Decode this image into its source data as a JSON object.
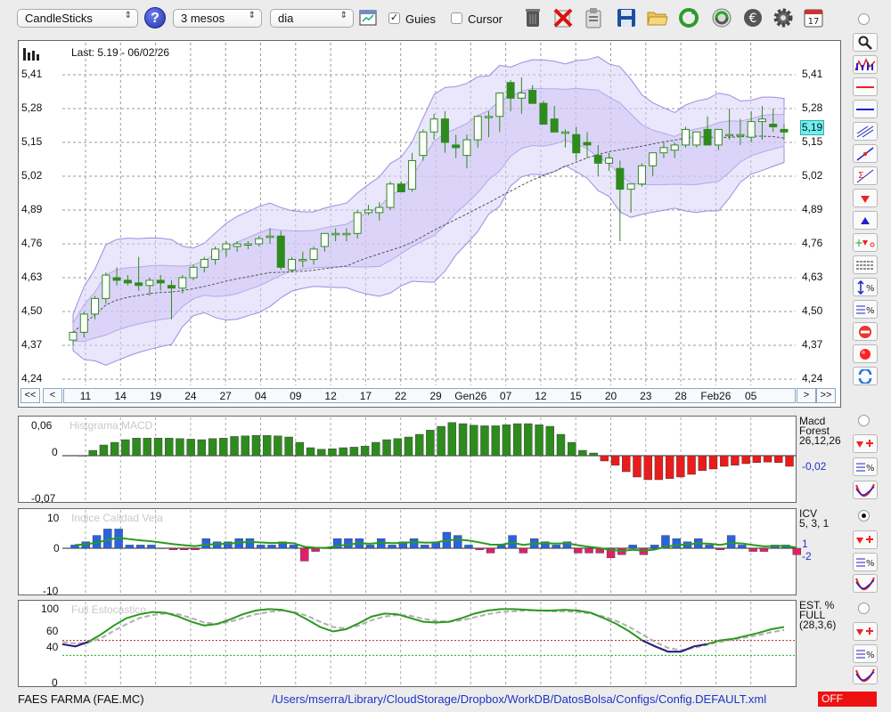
{
  "toolbar": {
    "chart_type": "CandleSticks",
    "help_label": "?",
    "period": "3 mesos",
    "interval": "dia",
    "guides_label": "Guies",
    "guides_checked": true,
    "cursor_label": "Cursor",
    "cursor_checked": false,
    "icons": [
      "table-icon",
      "trash-icon",
      "delete-icon",
      "clipboard-icon",
      "save-icon",
      "open-folder-icon",
      "refresh-icon",
      "sync-icon",
      "euro-icon",
      "gear-icon",
      "calendar-icon"
    ],
    "calendar_day": "17"
  },
  "main_chart": {
    "last_label": "Last: 5.19 - 06/02/26",
    "current_price": "5,19",
    "y_ticks": [
      "5,41",
      "5,28",
      "5,15",
      "5,02",
      "4,89",
      "4,76",
      "4,63",
      "4,50",
      "4,37",
      "4,24"
    ],
    "x_ticks": [
      "11",
      "14",
      "19",
      "24",
      "27",
      "04",
      "09",
      "12",
      "17",
      "22",
      "29",
      "Gen26",
      "07",
      "12",
      "15",
      "20",
      "23",
      "28",
      "Feb26",
      "05"
    ],
    "nav": {
      "first": "<<",
      "prev": "<",
      "next": ">",
      "last": ">>"
    }
  },
  "macd_panel": {
    "title": "Histgrama MACD",
    "y_ticks": [
      "0,06",
      "0",
      "-0,07"
    ],
    "side_lines": [
      "Macd",
      "Forest",
      "26,12,26"
    ],
    "value": "-0,02"
  },
  "icv_panel": {
    "title": "Indice Calidad Vela",
    "y_ticks": [
      "10",
      "0",
      "-10"
    ],
    "side_lines": [
      "ICV",
      "5, 3, 1"
    ],
    "value1": "1",
    "value2": "-2"
  },
  "stoch_panel": {
    "title": "Full Estocástico",
    "y_ticks": [
      "100",
      "60",
      "40",
      "0"
    ],
    "side_lines": [
      "EST. %",
      "FULL",
      "(28,3,6)"
    ]
  },
  "footer": {
    "company": "FAES FARMA (FAE.MC)",
    "config_path": "/Users/mserra/Library/CloudStorage/Dropbox/WorkDB/DatosBolsa/Configs/Config.DEFAULT.xml",
    "status": "OFF"
  },
  "colors": {
    "up": "#2e8b1e",
    "down": "#e81c1c",
    "band": "#d9d2f7",
    "accent": "#2233cc",
    "stoch_k": "#2a9a1e",
    "stoch_d": "#b0b0b0"
  },
  "chart_data": [
    {
      "type": "candlestick",
      "title": "Last: 5.19 - 06/02/26",
      "x_labels": [
        "11",
        "14",
        "19",
        "24",
        "27",
        "04",
        "09",
        "12",
        "17",
        "22",
        "29",
        "Gen26",
        "07",
        "12",
        "15",
        "20",
        "23",
        "28",
        "Feb26",
        "05"
      ],
      "ylim": [
        4.24,
        5.47
      ],
      "candles": [
        [
          4.39,
          4.42,
          4.37,
          4.42
        ],
        [
          4.42,
          4.5,
          4.4,
          4.49
        ],
        [
          4.49,
          4.56,
          4.47,
          4.55
        ],
        [
          4.55,
          4.65,
          4.53,
          4.64
        ],
        [
          4.63,
          4.67,
          4.6,
          4.62
        ],
        [
          4.62,
          4.64,
          4.6,
          4.61
        ],
        [
          4.61,
          4.71,
          4.58,
          4.6
        ],
        [
          4.6,
          4.63,
          4.56,
          4.62
        ],
        [
          4.62,
          4.64,
          4.58,
          4.61
        ],
        [
          4.6,
          4.62,
          4.47,
          4.59
        ],
        [
          4.59,
          4.64,
          4.57,
          4.63
        ],
        [
          4.63,
          4.68,
          4.62,
          4.67
        ],
        [
          4.67,
          4.71,
          4.65,
          4.7
        ],
        [
          4.7,
          4.75,
          4.68,
          4.74
        ],
        [
          4.74,
          4.77,
          4.71,
          4.76
        ],
        [
          4.75,
          4.77,
          4.73,
          4.76
        ],
        [
          4.76,
          4.77,
          4.74,
          4.76
        ],
        [
          4.76,
          4.79,
          4.75,
          4.78
        ],
        [
          4.79,
          4.82,
          4.76,
          4.79
        ],
        [
          4.79,
          4.81,
          4.66,
          4.67
        ],
        [
          4.66,
          4.71,
          4.65,
          4.7
        ],
        [
          4.7,
          4.73,
          4.67,
          4.7
        ],
        [
          4.7,
          4.75,
          4.68,
          4.74
        ],
        [
          4.75,
          4.8,
          4.73,
          4.8
        ],
        [
          4.8,
          4.82,
          4.77,
          4.8
        ],
        [
          4.8,
          4.82,
          4.77,
          4.8
        ],
        [
          4.8,
          4.89,
          4.78,
          4.88
        ],
        [
          4.88,
          4.91,
          4.87,
          4.89
        ],
        [
          4.88,
          4.92,
          4.85,
          4.9
        ],
        [
          4.9,
          5.0,
          4.89,
          4.99
        ],
        [
          4.99,
          5.0,
          4.96,
          4.96
        ],
        [
          4.97,
          5.11,
          4.96,
          5.08
        ],
        [
          5.1,
          5.2,
          5.08,
          5.19
        ],
        [
          5.19,
          5.26,
          5.16,
          5.24
        ],
        [
          5.24,
          5.27,
          5.11,
          5.15
        ],
        [
          5.14,
          5.18,
          5.09,
          5.13
        ],
        [
          5.1,
          5.18,
          5.05,
          5.16
        ],
        [
          5.16,
          5.25,
          5.13,
          5.25
        ],
        [
          5.25,
          5.27,
          5.17,
          5.25
        ],
        [
          5.25,
          5.34,
          5.19,
          5.34
        ],
        [
          5.38,
          5.39,
          5.27,
          5.32
        ],
        [
          5.32,
          5.4,
          5.26,
          5.34
        ],
        [
          5.35,
          5.37,
          5.3,
          5.3
        ],
        [
          5.3,
          5.31,
          5.26,
          5.22
        ],
        [
          5.24,
          5.29,
          5.19,
          5.19
        ],
        [
          5.19,
          5.2,
          5.13,
          5.19
        ],
        [
          5.18,
          5.21,
          5.08,
          5.11
        ],
        [
          5.15,
          5.19,
          5.09,
          5.14
        ],
        [
          5.1,
          5.14,
          5.02,
          5.07
        ],
        [
          5.07,
          5.11,
          5.04,
          5.09
        ],
        [
          5.05,
          5.08,
          4.77,
          4.97
        ],
        [
          4.97,
          4.99,
          4.88,
          4.99
        ],
        [
          4.99,
          5.07,
          4.98,
          5.06
        ],
        [
          5.06,
          5.11,
          5.02,
          5.11
        ],
        [
          5.11,
          5.15,
          5.09,
          5.13
        ],
        [
          5.12,
          5.15,
          5.09,
          5.14
        ],
        [
          5.14,
          5.21,
          5.13,
          5.2
        ],
        [
          5.14,
          5.19,
          5.13,
          5.19
        ],
        [
          5.2,
          5.25,
          5.16,
          5.14
        ],
        [
          5.14,
          5.2,
          5.12,
          5.2
        ],
        [
          5.18,
          5.28,
          5.16,
          5.18
        ],
        [
          5.18,
          5.24,
          5.14,
          5.18
        ],
        [
          5.17,
          5.27,
          5.15,
          5.23
        ],
        [
          5.23,
          5.29,
          5.16,
          5.24
        ],
        [
          5.22,
          5.28,
          5.19,
          5.21
        ],
        [
          5.2,
          5.22,
          5.16,
          5.19
        ]
      ]
    },
    {
      "type": "bar",
      "title": "Histgrama MACD",
      "ylim": [
        -0.07,
        0.06
      ],
      "values": [
        0.0,
        0.01,
        0.02,
        0.025,
        0.03,
        0.033,
        0.033,
        0.033,
        0.033,
        0.032,
        0.031,
        0.03,
        0.032,
        0.033,
        0.036,
        0.037,
        0.038,
        0.038,
        0.037,
        0.035,
        0.025,
        0.015,
        0.012,
        0.013,
        0.015,
        0.016,
        0.018,
        0.025,
        0.03,
        0.032,
        0.035,
        0.04,
        0.048,
        0.055,
        0.062,
        0.06,
        0.057,
        0.056,
        0.056,
        0.058,
        0.06,
        0.06,
        0.058,
        0.055,
        0.04,
        0.025,
        0.01,
        0.005,
        -0.01,
        -0.018,
        -0.03,
        -0.04,
        -0.045,
        -0.045,
        -0.043,
        -0.04,
        -0.035,
        -0.028,
        -0.025,
        -0.02,
        -0.018,
        -0.015,
        -0.013,
        -0.012,
        -0.013,
        -0.02
      ]
    },
    {
      "type": "bar",
      "title": "Indice Calidad Vela",
      "ylim": [
        -10,
        10
      ],
      "values": [
        1,
        2,
        4,
        6,
        6,
        1,
        1,
        1,
        0,
        -0.5,
        -0.5,
        -0.5,
        3,
        2,
        2,
        3,
        3,
        1,
        1,
        2,
        1,
        -4,
        -1,
        0,
        3,
        3,
        3,
        1,
        3,
        1,
        2,
        3,
        1,
        2,
        5,
        4,
        1,
        -0.5,
        -1.5,
        1,
        4,
        -1.5,
        3,
        2,
        1,
        2,
        -1.5,
        -1.5,
        -1.5,
        -3,
        -2,
        1,
        -2,
        1,
        4,
        3,
        2,
        3,
        1,
        -0.5,
        4,
        1,
        -1,
        -1,
        1,
        1,
        -2
      ]
    },
    {
      "type": "line",
      "title": "Full Estocástico",
      "ylim": [
        0,
        100
      ],
      "series": [
        {
          "values": [
            55,
            52,
            58,
            68,
            80,
            90,
            95,
            98,
            97,
            92,
            85,
            80,
            82,
            88,
            95,
            100,
            102,
            101,
            97,
            88,
            78,
            72,
            75,
            83,
            92,
            96,
            95,
            90,
            85,
            84,
            85,
            90,
            96,
            100,
            102,
            102,
            101,
            100,
            100,
            101,
            100,
            97,
            90,
            82,
            72,
            60,
            52,
            45,
            45,
            52,
            55,
            60,
            62,
            66,
            70,
            75,
            78
          ]
        },
        {
          "values": [
            58,
            56,
            57,
            63,
            73,
            82,
            90,
            94,
            96,
            95,
            90,
            84,
            82,
            85,
            90,
            95,
            98,
            100,
            98,
            93,
            85,
            78,
            76,
            80,
            87,
            92,
            94,
            93,
            89,
            86,
            85,
            87,
            91,
            95,
            98,
            99,
            100,
            100,
            99,
            99,
            98,
            96,
            92,
            86,
            78,
            68,
            58,
            50,
            47,
            50,
            54,
            58,
            61,
            64,
            67,
            71,
            74
          ]
        }
      ]
    }
  ]
}
